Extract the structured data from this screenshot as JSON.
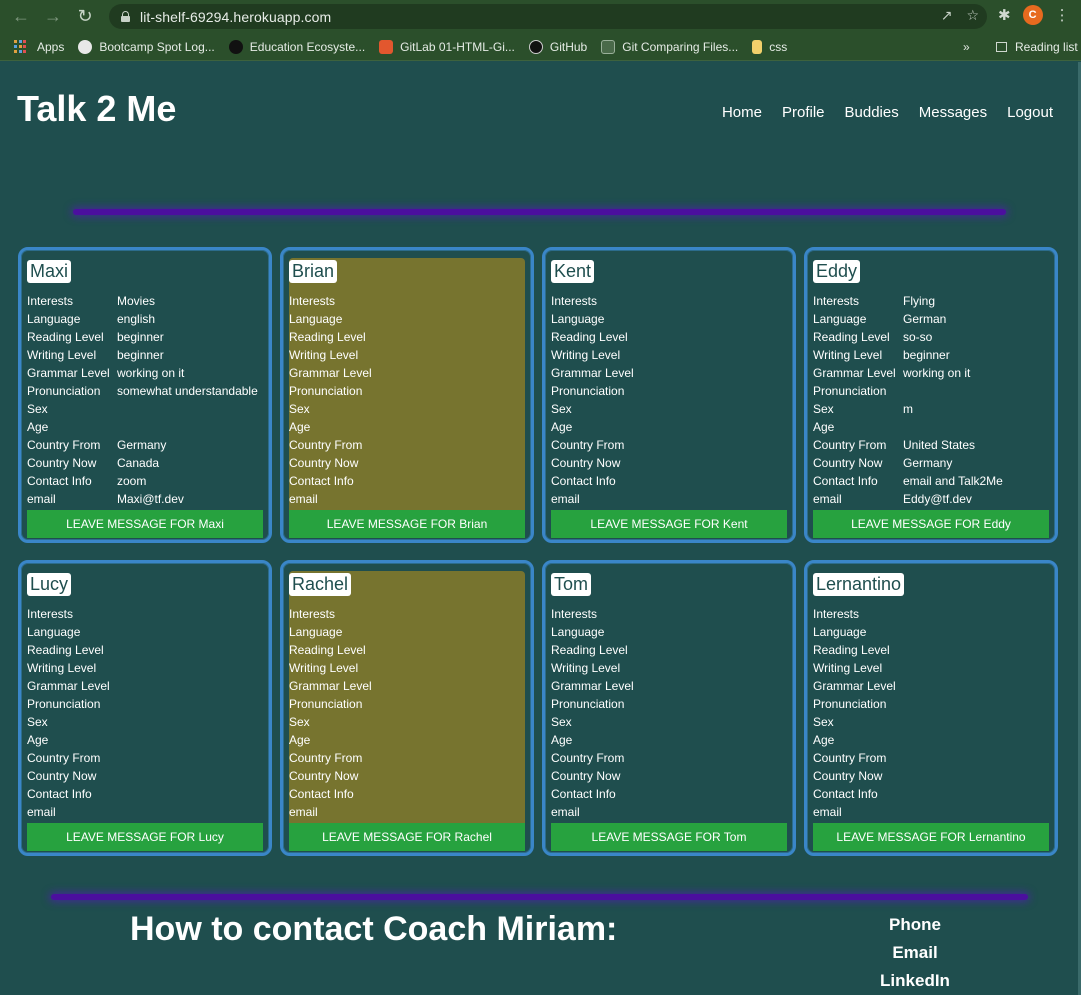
{
  "browser": {
    "url": "lit-shelf-69294.herokuapp.com",
    "profile_initial": "C",
    "bookmarks": [
      "Apps",
      "Bootcamp Spot Log...",
      "Education Ecosyste...",
      "GitLab 01-HTML-Gi...",
      "GitHub",
      "Git Comparing Files...",
      "css"
    ],
    "more": "»",
    "reading_list": "Reading list"
  },
  "header": {
    "title": "Talk 2 Me",
    "nav": [
      "Home",
      "Profile",
      "Buddies",
      "Messages",
      "Logout"
    ]
  },
  "field_labels": [
    "Interests",
    "Language",
    "Reading Level",
    "Writing Level",
    "Grammar Level",
    "Pronunciation",
    "Sex",
    "Age",
    "Country From",
    "Country Now",
    "Contact Info",
    "email"
  ],
  "cards": [
    {
      "name": "Maxi",
      "highlight": false,
      "values": [
        "Movies",
        "english",
        "beginner",
        "beginner",
        "working on it",
        "somewhat understandable",
        "",
        "",
        "Germany",
        "Canada",
        "zoom",
        "Maxi@tf.dev"
      ],
      "button": "LEAVE MESSAGE FOR Maxi"
    },
    {
      "name": "Brian",
      "highlight": true,
      "values": [
        "",
        "",
        "",
        "",
        "",
        "",
        "",
        "",
        "",
        "",
        "",
        ""
      ],
      "button": "LEAVE MESSAGE FOR Brian"
    },
    {
      "name": "Kent",
      "highlight": false,
      "values": [
        "",
        "",
        "",
        "",
        "",
        "",
        "",
        "",
        "",
        "",
        "",
        ""
      ],
      "button": "LEAVE MESSAGE FOR Kent"
    },
    {
      "name": "Eddy",
      "highlight": false,
      "values": [
        "Flying",
        "German",
        "so-so",
        "beginner",
        "working on it",
        "",
        "m",
        "",
        "United States",
        "Germany",
        "email and Talk2Me",
        "Eddy@tf.dev"
      ],
      "button": "LEAVE MESSAGE FOR Eddy"
    },
    {
      "name": "Lucy",
      "highlight": false,
      "values": [
        "",
        "",
        "",
        "",
        "",
        "",
        "",
        "",
        "",
        "",
        "",
        ""
      ],
      "button": "LEAVE MESSAGE FOR Lucy"
    },
    {
      "name": "Rachel",
      "highlight": true,
      "values": [
        "",
        "",
        "",
        "",
        "",
        "",
        "",
        "",
        "",
        "",
        "",
        ""
      ],
      "button": "LEAVE MESSAGE FOR Rachel"
    },
    {
      "name": "Tom",
      "highlight": false,
      "values": [
        "",
        "",
        "",
        "",
        "",
        "",
        "",
        "",
        "",
        "",
        "",
        ""
      ],
      "button": "LEAVE MESSAGE FOR Tom"
    },
    {
      "name": "Lernantino",
      "highlight": false,
      "values": [
        "",
        "",
        "",
        "",
        "",
        "",
        "",
        "",
        "",
        "",
        "",
        ""
      ],
      "button": "LEAVE MESSAGE FOR Lernantino"
    }
  ],
  "contact": {
    "heading": "How to contact Coach Miriam:",
    "links": [
      "Phone",
      "Email",
      "LinkedIn"
    ]
  },
  "colors": {
    "page_bg": "#1f4e4e",
    "card_border": "#3a86c8",
    "highlight_bg": "#77742f",
    "button_bg": "#27a23f",
    "divider": "#4b0f9e",
    "chrome_bg": "#2b4f2b"
  },
  "icons": [
    "back-icon",
    "forward-icon",
    "reload-icon",
    "lock-icon",
    "share-icon",
    "star-icon",
    "extensions-icon",
    "menu-icon",
    "reading-list-icon"
  ]
}
